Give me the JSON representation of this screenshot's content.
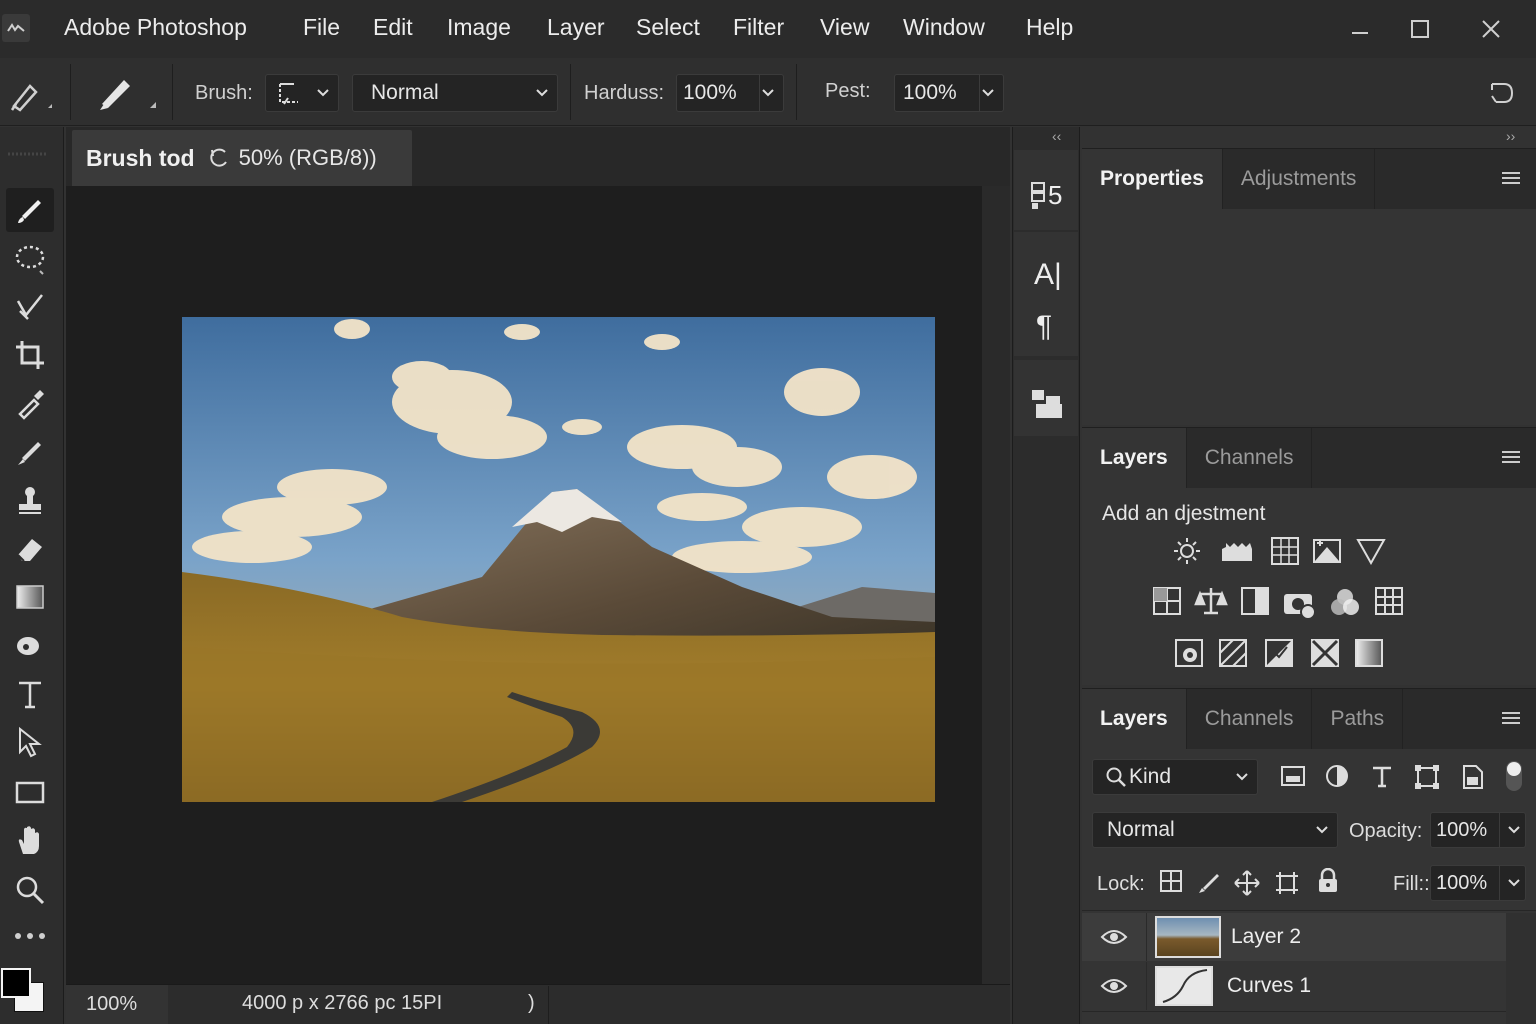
{
  "app": {
    "title": "Adobe Photoshop",
    "menu": [
      "File",
      "Edit",
      "Image",
      "Layer",
      "Select",
      "Filter",
      "View",
      "Window",
      "Help"
    ]
  },
  "options": {
    "brush_label": "Brush:",
    "mode_value": "Normal",
    "hardness_label": "Harduss:",
    "hardness_value": "100%",
    "pest_label": "Pest:",
    "pest_value": "100%"
  },
  "document": {
    "tab_name": "Brush tod",
    "tab_info": "50% (RGB/8))",
    "zoom": "100%",
    "dimensions": "4000 p x 2766 pc 15PI",
    "status_arrow": ")"
  },
  "strip": {
    "item1": "5",
    "item2": "A|",
    "item3": "¶"
  },
  "properties_panel": {
    "tabs": [
      "Properties",
      "Adjustments"
    ],
    "active_tab": 0
  },
  "adjustments_panel": {
    "tabs": [
      "Layers",
      "Channels"
    ],
    "heading": "Add an djestment"
  },
  "layers_panel": {
    "tabs": [
      "Layers",
      "Channels",
      "Paths"
    ],
    "filter_value": "Kind",
    "blend_mode": "Normal",
    "opacity_label": "Opacity:",
    "opacity_value": "100%",
    "lock_label": "Lock:",
    "fill_label": "Fill::",
    "fill_value": "100%",
    "layers": [
      {
        "name": "Layer 2",
        "selected": true
      },
      {
        "name": "Curves 1",
        "selected": false
      }
    ]
  },
  "colors": {
    "accent_bg": "#2b2b2b",
    "panel_bg": "#343434",
    "canvas_bg": "#1e1e1e"
  }
}
